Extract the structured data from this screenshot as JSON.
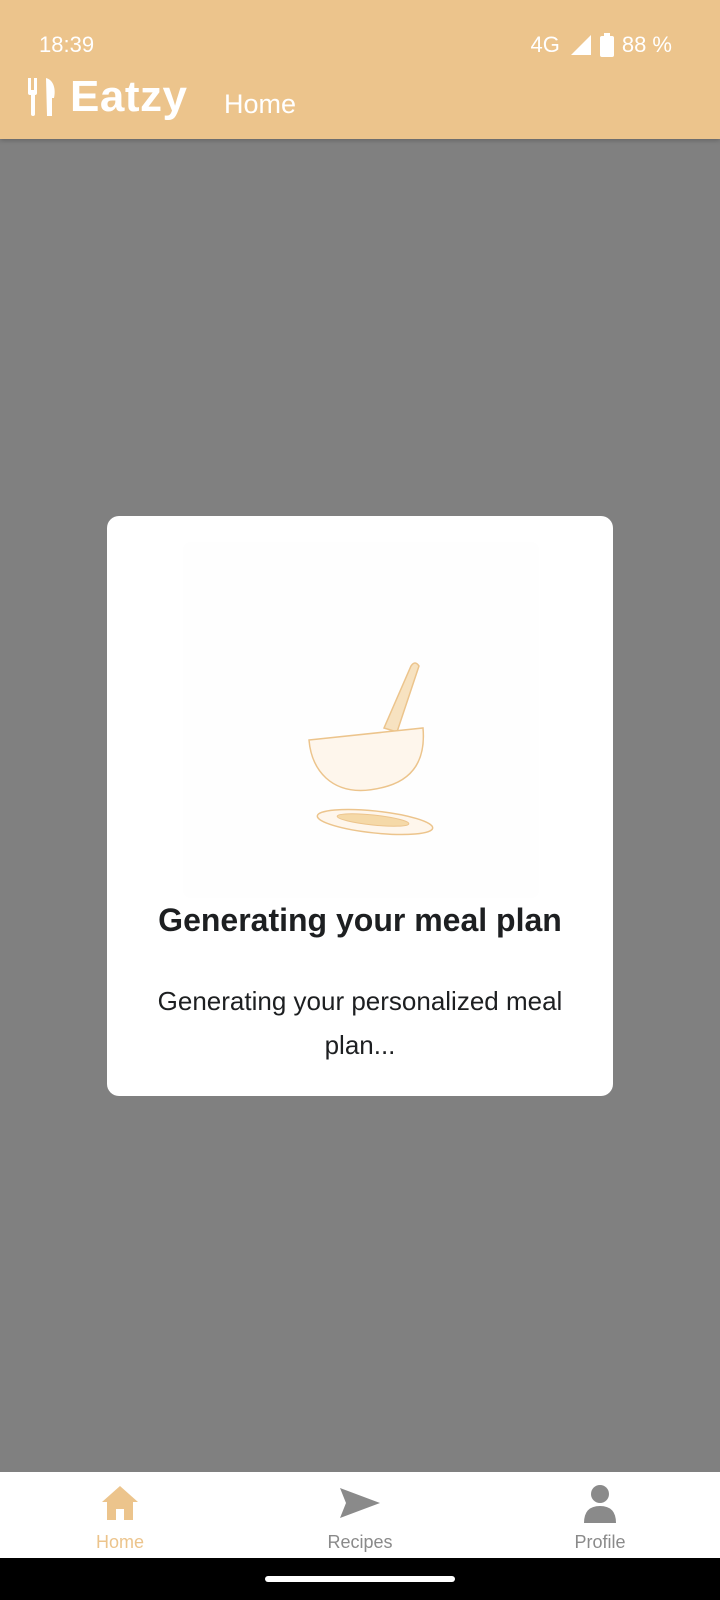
{
  "status_bar": {
    "time": "18:39",
    "network": "4G",
    "battery": "88 %"
  },
  "header": {
    "app_name": "Eatzy",
    "page_title": "Home"
  },
  "dialog": {
    "title": "Generating your meal plan",
    "message": "Generating your personalized meal plan..."
  },
  "bottom_nav": {
    "items": [
      {
        "label": "Home",
        "icon": "home-icon",
        "active": true
      },
      {
        "label": "Recipes",
        "icon": "send-icon",
        "active": false
      },
      {
        "label": "Profile",
        "icon": "person-icon",
        "active": false
      }
    ]
  },
  "colors": {
    "accent": "#ECC48C",
    "overlay": "#808080",
    "inactive": "#8a8a8a",
    "text": "#1d1f21"
  }
}
